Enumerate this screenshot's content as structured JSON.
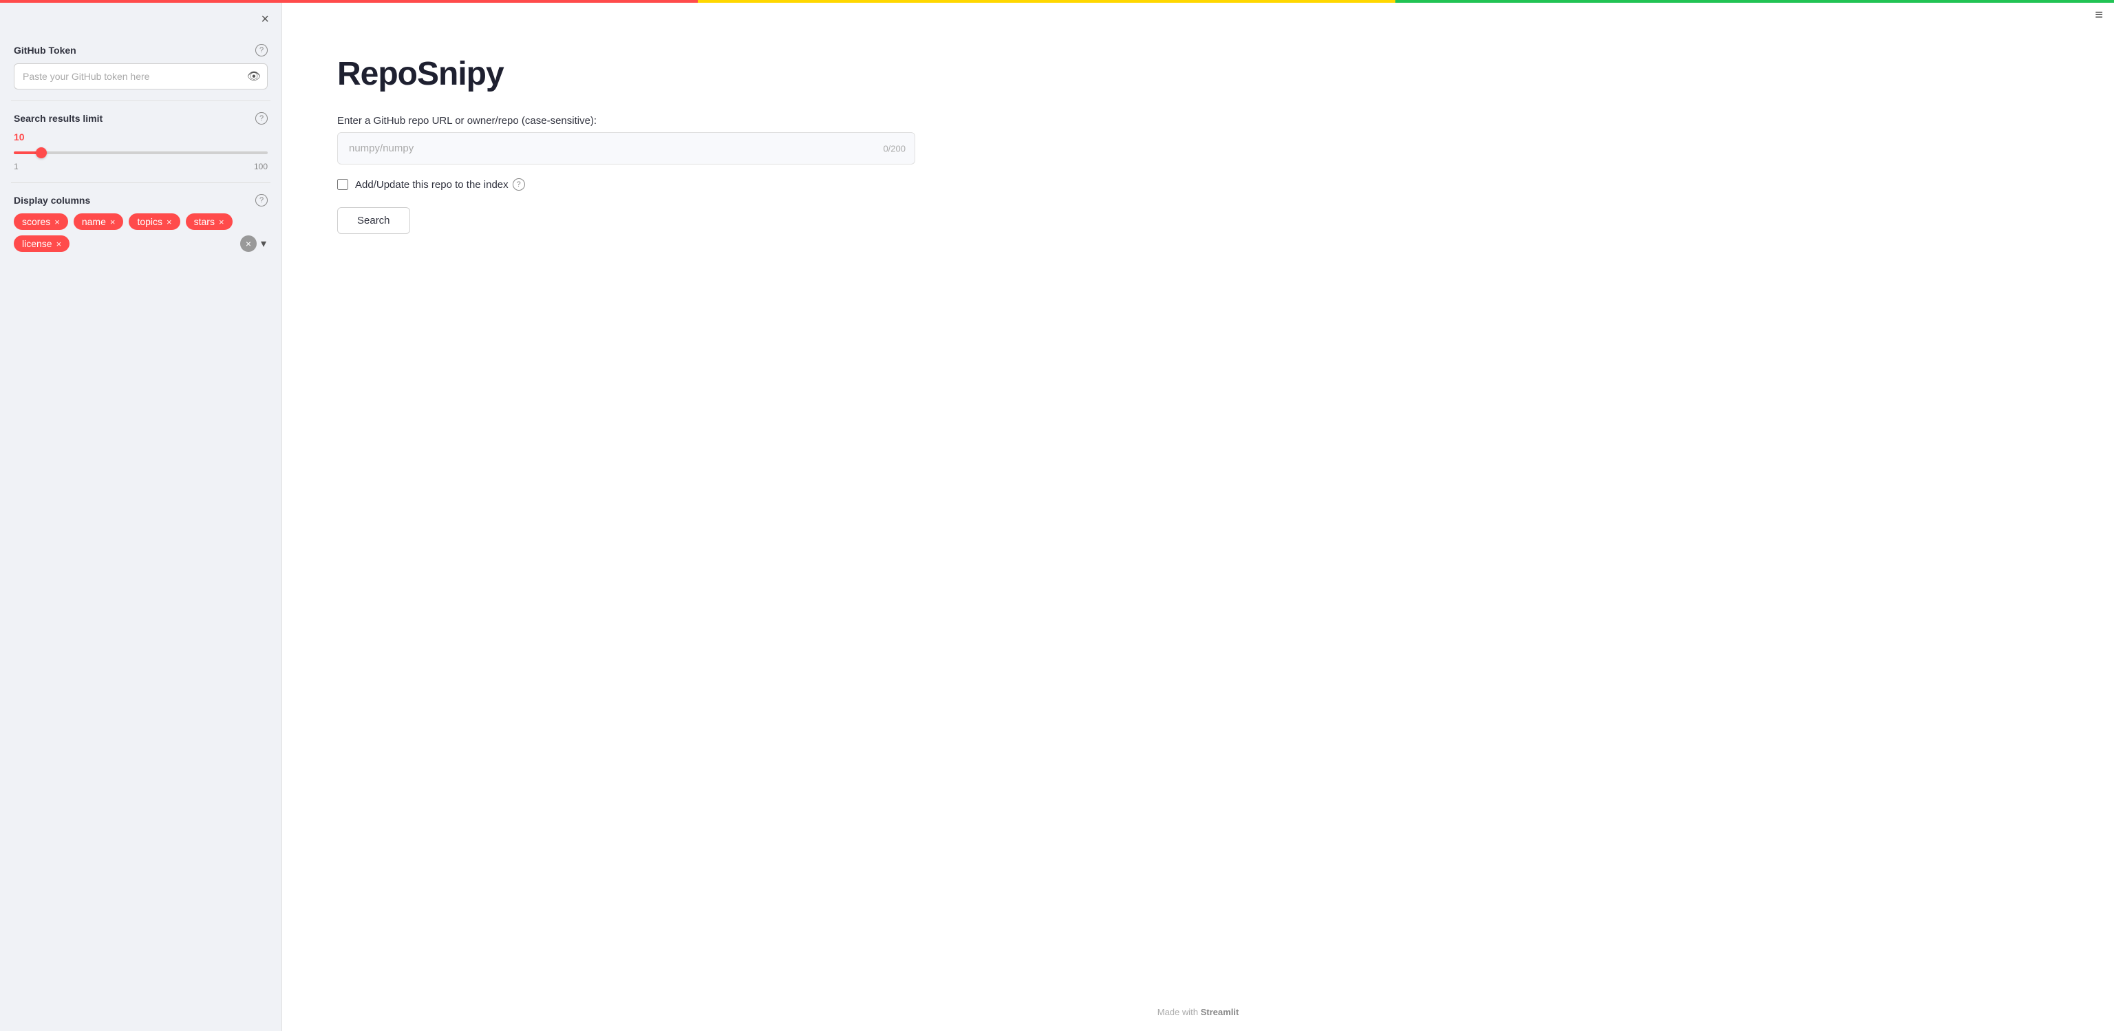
{
  "sidebar": {
    "close_label": "×",
    "github_token": {
      "title": "GitHub Token",
      "placeholder": "Paste your GitHub token here",
      "value": ""
    },
    "search_results_limit": {
      "title": "Search results limit",
      "value": 10,
      "min": 1,
      "max": 100,
      "min_label": "1",
      "max_label": "100",
      "percent": 9
    },
    "display_columns": {
      "title": "Display columns",
      "tags": [
        {
          "label": "scores",
          "id": "scores"
        },
        {
          "label": "name",
          "id": "name"
        },
        {
          "label": "topics",
          "id": "topics"
        },
        {
          "label": "stars",
          "id": "stars"
        },
        {
          "label": "license",
          "id": "license"
        }
      ]
    }
  },
  "main": {
    "title": "RepoSnipy",
    "form_label": "Enter a GitHub repo URL or owner/repo (case-sensitive):",
    "repo_input": {
      "placeholder": "numpy/numpy",
      "value": "",
      "char_count": "0/200"
    },
    "add_update_checkbox": {
      "label": "Add/Update this repo to the index",
      "checked": false
    },
    "search_button": "Search",
    "hamburger_icon": "≡"
  },
  "footer": {
    "prefix": "Made with",
    "brand": "Streamlit"
  }
}
